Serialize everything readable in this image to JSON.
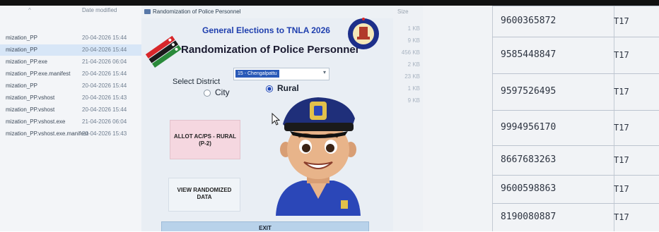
{
  "explorer": {
    "header_date": "Date modified",
    "files": [
      {
        "name": "mization_PP",
        "date": "20-04-2026 15:44",
        "selected": false
      },
      {
        "name": "mization_PP",
        "date": "20-04-2026 15:44",
        "selected": true
      },
      {
        "name": "mization_PP.exe",
        "date": "21-04-2026 06:04",
        "selected": false
      },
      {
        "name": "mization_PP.exe.manifest",
        "date": "20-04-2026 15:44",
        "selected": false
      },
      {
        "name": "mization_PP",
        "date": "20-04-2026 15:44",
        "selected": false
      },
      {
        "name": "mization_PP.vshost",
        "date": "20-04-2026 15:43",
        "selected": false
      },
      {
        "name": "mization_PP.vshost",
        "date": "20-04-2026 15:44",
        "selected": false
      },
      {
        "name": "mization_PP.vshost.exe",
        "date": "21-04-2026 06:04",
        "selected": false
      },
      {
        "name": "mization_PP.vshost.exe.manifest",
        "date": "20-04-2026 15:43",
        "selected": false
      }
    ]
  },
  "sizes": {
    "header": "Size",
    "values": [
      "1 KB",
      "9 KB",
      "456 KB",
      "2 KB",
      "23 KB",
      "1 KB",
      "9 KB"
    ]
  },
  "app": {
    "window_title": "Randomization of Police Personnel",
    "heading1": "General Elections to TNLA 2026",
    "heading2": "Randomization of Police Personnel",
    "district_label": "Select District",
    "district_value": "15 - Chengalpattu",
    "radio_city": "City",
    "radio_rural": "Rural",
    "selected_radio": "Rural",
    "btn_allot": "ALLOT AC/PS - RURAL (P-2)",
    "btn_view": "VIEW RANDOMIZED DATA",
    "btn_exit": "EXIT"
  },
  "phones": [
    {
      "phone": "9600365872",
      "code": "T17"
    },
    {
      "phone": "9585448847",
      "code": "T17"
    },
    {
      "phone": "9597526495",
      "code": "T17"
    },
    {
      "phone": "9994956170",
      "code": "T17"
    },
    {
      "phone": "8667683263",
      "code": "T17"
    },
    {
      "phone": "9600598863",
      "code": "T17"
    },
    {
      "phone": "8190080887",
      "code": "T17"
    }
  ],
  "colors": {
    "heading_blue": "#1f3fae",
    "allot_button": "#f5d7e0",
    "exit_button": "#b8d2ea"
  }
}
